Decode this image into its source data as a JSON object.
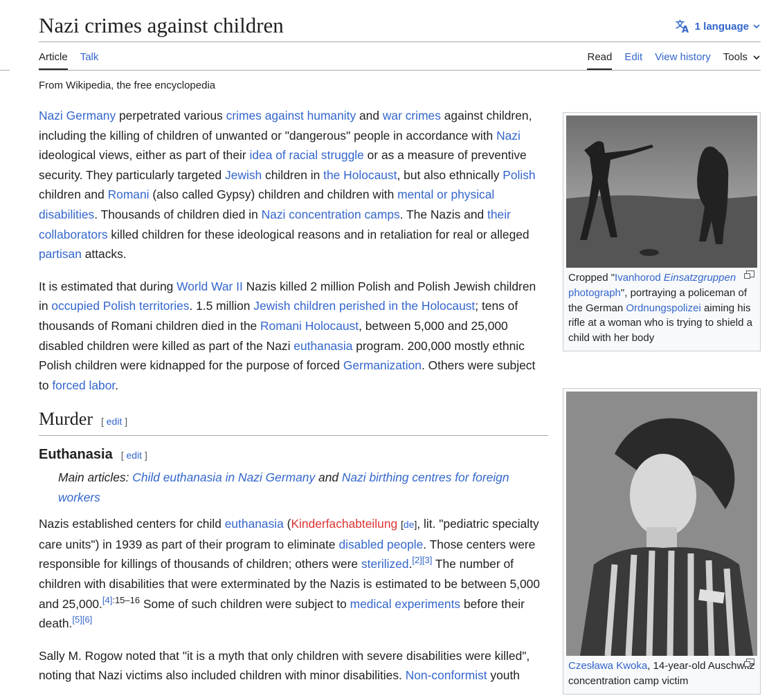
{
  "page": {
    "title": "Nazi crimes against children",
    "language_button": "1 language",
    "tagline": "From Wikipedia, the free encyclopedia"
  },
  "tabs_left": [
    "Article",
    "Talk"
  ],
  "tabs_right": [
    "Read",
    "Edit",
    "View history",
    "Tools"
  ],
  "p1": {
    "a1": "Nazi Germany",
    "t1": " perpetrated various ",
    "a2": "crimes against humanity",
    "t2": " and ",
    "a3": "war crimes",
    "t3": " against children, including the killing of children of unwanted or \"dangerous\" people in accordance with ",
    "a4": "Nazi",
    "t4": " ideological views, either as part of their ",
    "a5": "idea of racial struggle",
    "t5": " or as a measure of preventive security. They particularly targeted ",
    "a6": "Jewish",
    "t6": " children in ",
    "a7": "the Holocaust",
    "t7": ", but also ethnically ",
    "a8": "Polish",
    "t8": " children and ",
    "a9": "Romani",
    "t9": " (also called Gypsy) children and children with ",
    "a10": "mental or physical disabilities",
    "t10": ". Thousands of children died in ",
    "a11": "Nazi concentration camps",
    "t11": ". The Nazis and ",
    "a12": "their collaborators",
    "t12": " killed children for these ideological reasons and in retaliation for real or alleged ",
    "a13": "partisan",
    "t13": " attacks."
  },
  "p2": {
    "t0": "It is estimated that during ",
    "a1": "World War II",
    "t1": " Nazis killed 2 million Polish and Polish Jewish children in ",
    "a2": "occupied Polish territories",
    "t2": ". 1.5 million ",
    "a3": "Jewish children perished in the Holocaust",
    "t3": "; tens of thousands of Romani children died in the ",
    "a4": "Romani Holocaust",
    "t4": ", between 5,000 and 25,000 disabled children were killed as part of the Nazi ",
    "a5": "euthanasia",
    "t5": " program. 200,000 mostly ethnic Polish children were kidnapped for the purpose of forced ",
    "a6": "Germanization",
    "t6": ". Others were subject to ",
    "a7": "forced labor",
    "t7": "."
  },
  "section_murder": {
    "title": "Murder",
    "edit": "edit"
  },
  "section_euthanasia": {
    "title": "Euthanasia",
    "edit": "edit"
  },
  "hatnote": {
    "prefix": "Main articles: ",
    "a1": "Child euthanasia in Nazi Germany",
    "mid": " and ",
    "a2": "Nazi birthing centres for foreign workers"
  },
  "p3": {
    "t0": "Nazis established centers for child ",
    "a1": "euthanasia",
    "t1": " (",
    "red": "Kinderfachabteilung",
    "t1b": " ",
    "de": "de",
    "t2": ", lit. \"pediatric specialty care units\") in 1939 as part of their program to eliminate ",
    "a2": "disabled people",
    "t3": ". Those centers were responsible for killings of thousands of children; others were ",
    "a3": "sterilized",
    "t4": ".",
    "r1": "[2]",
    "r2": "[3]",
    "t5": " The number of children with disabilities that were exterminated by the Nazis is estimated to be between 5,000 and 25,000.",
    "r3": "[4]",
    "r3b": ":15–16",
    "t6": " Some of such children were subject to ",
    "a4": "medical experiments",
    "t7": " before their death.",
    "r4": "[5]",
    "r5": "[6]"
  },
  "p4": {
    "t0": "Sally M. Rogow noted that \"it is a myth that only children with severe disabilities were killed\", noting that Nazi victims also included children with minor disabilities. ",
    "a1": "Non-conformist",
    "t1": " youth"
  },
  "figure1": {
    "c0": "Cropped \"",
    "a1": "Ivanhorod ",
    "a1i": "Einsatzgruppen",
    "a1b": " photograph",
    "c1": "\", portraying a policeman of the German ",
    "a2": "Ordnungspolizei",
    "c2": " aiming his rifle at a woman who is trying to shield a child with her body"
  },
  "figure2": {
    "a1": "Czesława Kwoka",
    "c1": ", 14-year-old Auschwitz concentration camp victim"
  }
}
